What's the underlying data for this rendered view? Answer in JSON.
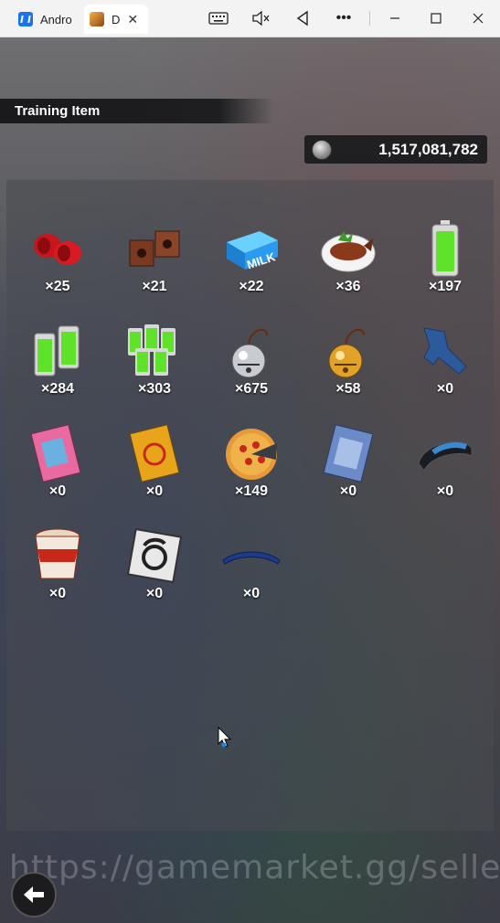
{
  "window": {
    "tabs": [
      {
        "label": "Andro",
        "icon": "android-app-icon"
      },
      {
        "label": "D",
        "icon": "game-app-icon"
      }
    ],
    "controls": [
      "keyboard-icon",
      "mute-icon",
      "back-triangle-icon",
      "more-icon",
      "minimize-icon",
      "maximize-icon",
      "close-icon"
    ]
  },
  "header": {
    "title": "Training Item"
  },
  "currency": {
    "value": "1,517,081,782",
    "icon": "coin-icon"
  },
  "items": [
    {
      "icon": "red-weights-icon",
      "count": "×25"
    },
    {
      "icon": "brick-weights-icon",
      "count": "×21"
    },
    {
      "icon": "milk-brick-icon",
      "count": "×22"
    },
    {
      "icon": "fish-dish-icon",
      "count": "×36"
    },
    {
      "icon": "energy-battery-icon",
      "count": "×197"
    },
    {
      "icon": "battery-pack-icon",
      "count": "×284"
    },
    {
      "icon": "battery-crate-icon",
      "count": "×303"
    },
    {
      "icon": "silver-bell-icon",
      "count": "×675"
    },
    {
      "icon": "gold-bell-icon",
      "count": "×58"
    },
    {
      "icon": "jeans-icon",
      "count": "×0"
    },
    {
      "icon": "pink-magazine-icon",
      "count": "×0"
    },
    {
      "icon": "orange-book-icon",
      "count": "×0"
    },
    {
      "icon": "pizza-icon",
      "count": "×149"
    },
    {
      "icon": "comic-book-icon",
      "count": "×0"
    },
    {
      "icon": "wristband-icon",
      "count": "×0"
    },
    {
      "icon": "cup-noodle-icon",
      "count": "×0"
    },
    {
      "icon": "emblem-card-icon",
      "count": "×0"
    },
    {
      "icon": "headband-icon",
      "count": "×0"
    }
  ],
  "watermark": "https://gamemarket.gg/seller/",
  "back_button": {
    "icon": "back-arrow-icon"
  }
}
